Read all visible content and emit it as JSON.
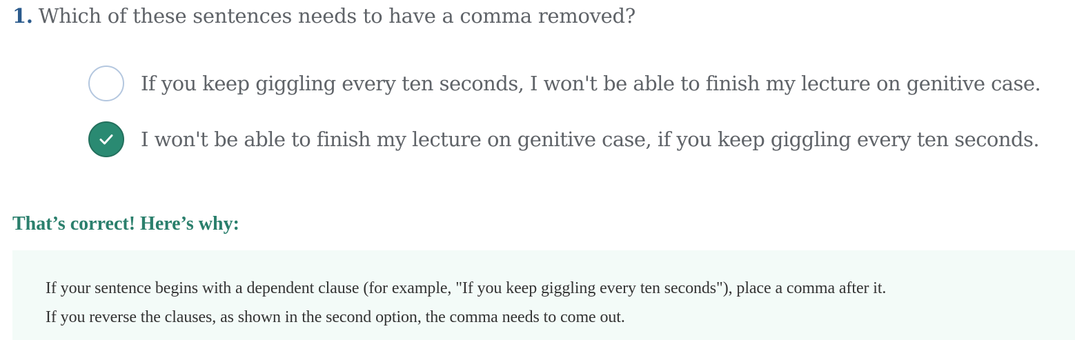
{
  "question": {
    "number": "1.",
    "text": "Which of these sentences needs to have a comma removed?"
  },
  "options": [
    {
      "text": "If you keep giggling every ten seconds, I won't be able to finish my lecture on genitive case.",
      "selected": false
    },
    {
      "text": "I won't be able to finish my lecture on genitive case, if you keep giggling every ten seconds.",
      "selected": true
    }
  ],
  "feedback": {
    "heading": "That’s correct! Here’s why:",
    "lines": [
      "If your sentence begins with a dependent clause (for example, \"If you keep giggling every ten seconds\"), place a comma after it.",
      "If you reverse the clauses, as shown in the second option, the comma needs to come out."
    ]
  },
  "colors": {
    "question_number": "#2a5a8c",
    "correct_green": "#2a8a72",
    "heading_green": "#2a7f6c",
    "explanation_bg": "#f3fbf8",
    "radio_border": "#b4c7df"
  },
  "icons": {
    "selected_marker": "checkmark-icon"
  }
}
